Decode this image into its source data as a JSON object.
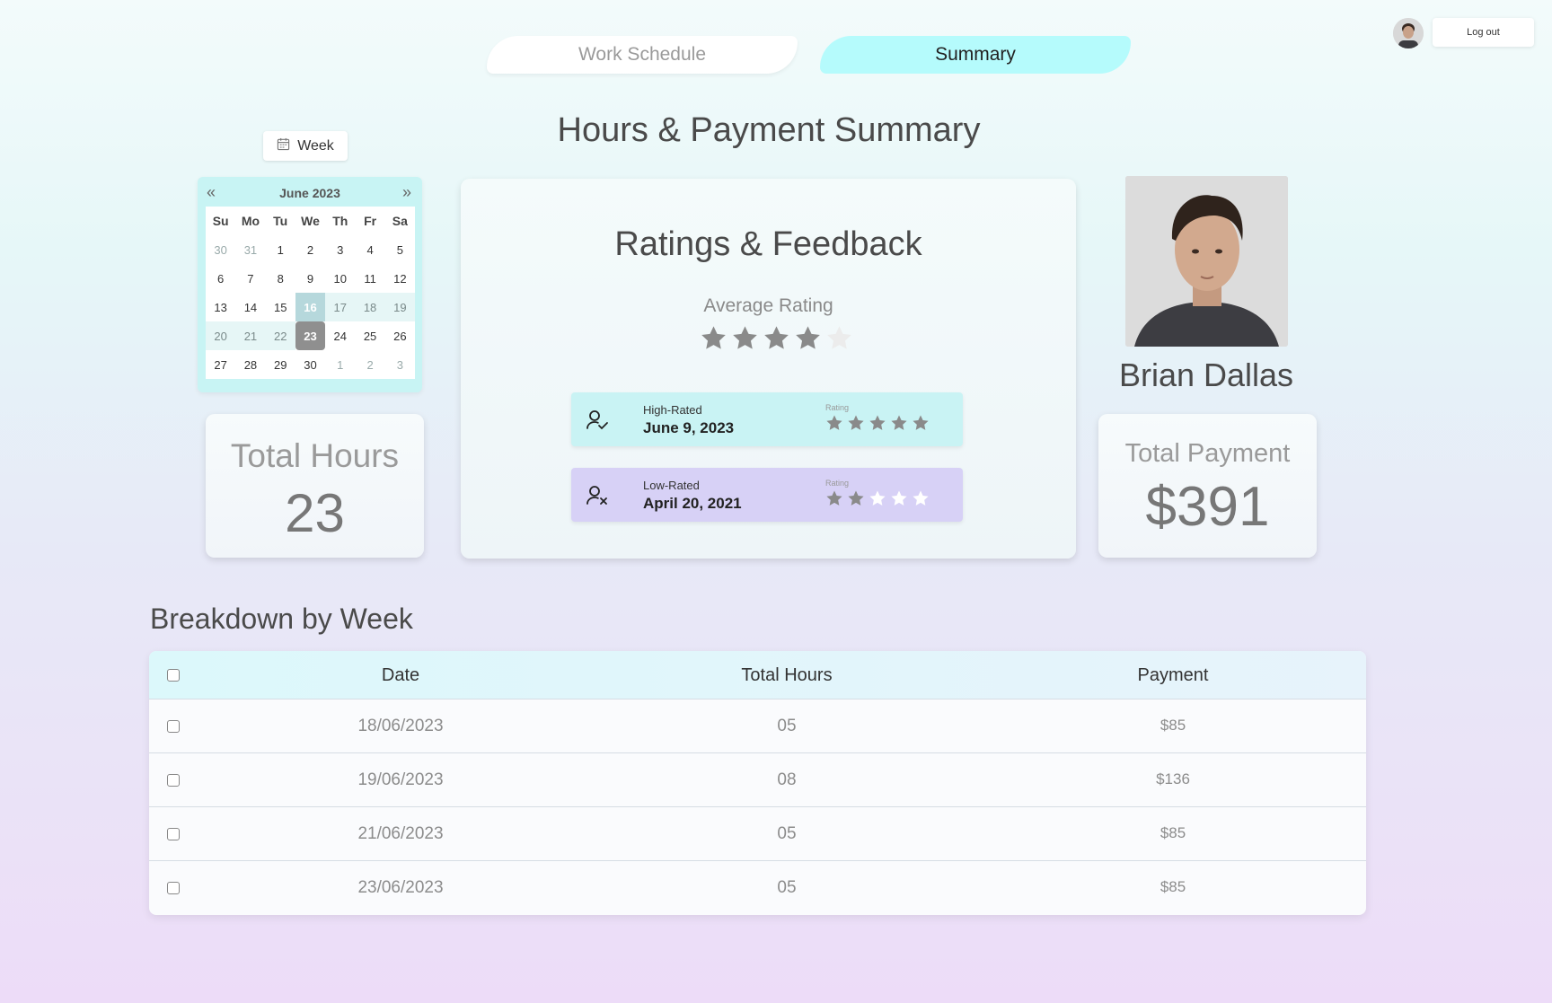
{
  "tabs": [
    {
      "label": "Work Schedule",
      "active": false
    },
    {
      "label": "Summary",
      "active": true
    }
  ],
  "user": {
    "logout_label": "Log out"
  },
  "page_title": "Hours & Payment Summary",
  "week_button": {
    "label": "Week",
    "icon": "calendar-icon"
  },
  "calendar": {
    "month_label": "June 2023",
    "day_headers": [
      "Su",
      "Mo",
      "Tu",
      "We",
      "Th",
      "Fr",
      "Sa"
    ],
    "weeks": [
      [
        "30",
        "31",
        "1",
        "2",
        "3",
        "4",
        "5"
      ],
      [
        "6",
        "7",
        "8",
        "9",
        "10",
        "11",
        "12"
      ],
      [
        "13",
        "14",
        "15",
        "16",
        "17",
        "18",
        "19"
      ],
      [
        "20",
        "21",
        "22",
        "23",
        "24",
        "25",
        "26"
      ],
      [
        "27",
        "28",
        "29",
        "30",
        "1",
        "2",
        "3"
      ]
    ],
    "range_start": "16",
    "range_end": "23"
  },
  "total_hours": {
    "label": "Total Hours",
    "value": "23"
  },
  "ratings": {
    "title": "Ratings & Feedback",
    "average_label": "Average Rating",
    "average_stars": 4,
    "max_stars": 5,
    "high": {
      "kind": "High-Rated",
      "date": "June 9, 2023",
      "rating_label": "Rating",
      "stars": 5
    },
    "low": {
      "kind": "Low-Rated",
      "date": "April 20, 2021",
      "rating_label": "Rating",
      "stars": 2
    }
  },
  "profile": {
    "name": "Brian Dallas"
  },
  "total_payment": {
    "label": "Total Payment",
    "value": "$391"
  },
  "breakdown": {
    "title": "Breakdown by Week",
    "columns": [
      "Date",
      "Total Hours",
      "Payment"
    ],
    "rows": [
      {
        "date": "18/06/2023",
        "hours": "05",
        "payment": "$85"
      },
      {
        "date": "19/06/2023",
        "hours": "08",
        "payment": "$136"
      },
      {
        "date": "21/06/2023",
        "hours": "05",
        "payment": "$85"
      },
      {
        "date": "23/06/2023",
        "hours": "05",
        "payment": "$85"
      }
    ]
  },
  "colors": {
    "star_filled": "#8a8a8a",
    "star_empty_light": "#ffffff",
    "star_empty_avg": "#ececec",
    "tab_active": "#b5fbfc",
    "high_card": "#c9f3f4",
    "low_card": "#d7d1f6"
  }
}
